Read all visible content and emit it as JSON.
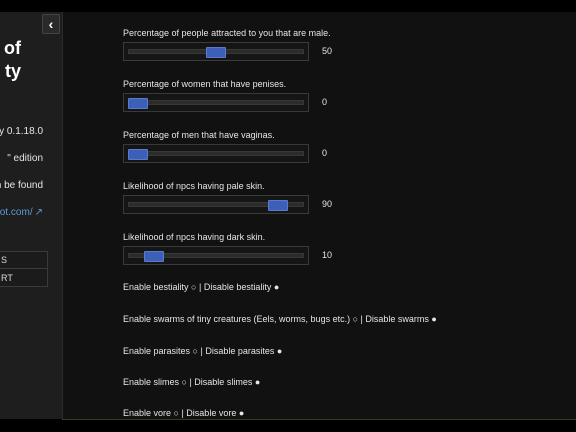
{
  "sidebar": {
    "collapse_icon": "‹",
    "title_lines": [
      "s of",
      "ty"
    ],
    "version": "y 0.1.18.0",
    "edition": "\" edition",
    "found_text": "an be found",
    "link_text": "pot.com/",
    "link_icon": "↗",
    "buttons": [
      "S",
      "RT"
    ]
  },
  "sliders": [
    {
      "label": "Percentage of people attracted to you that are male.",
      "value": "50",
      "level": 0.5
    },
    {
      "label": "Percentage of women that have penises.",
      "value": "0",
      "level": 0.0
    },
    {
      "label": "Percentage of men that have vaginas.",
      "value": "0",
      "level": 0.0
    },
    {
      "label": "Likelihood of npcs having pale skin.",
      "value": "90",
      "level": 0.9
    },
    {
      "label": "Likelihood of npcs having dark skin.",
      "value": "10",
      "level": 0.1
    }
  ],
  "toggles": [
    {
      "text": "Enable bestiality ○ | Disable bestiality ●"
    },
    {
      "text": "Enable swarms of tiny creatures (Eels, worms, bugs etc.) ○ | Disable swarms ●"
    },
    {
      "text": "Enable parasites ○ | Disable parasites ●"
    },
    {
      "text": "Enable slimes ○ | Disable slimes ●"
    },
    {
      "text": "Enable vore ○ | Disable vore ●"
    }
  ],
  "colors": {
    "background": "#111111",
    "sidebar": "#1e1e1e",
    "slider_thumb": "#3e5fb8",
    "link": "#5b9bd5"
  }
}
